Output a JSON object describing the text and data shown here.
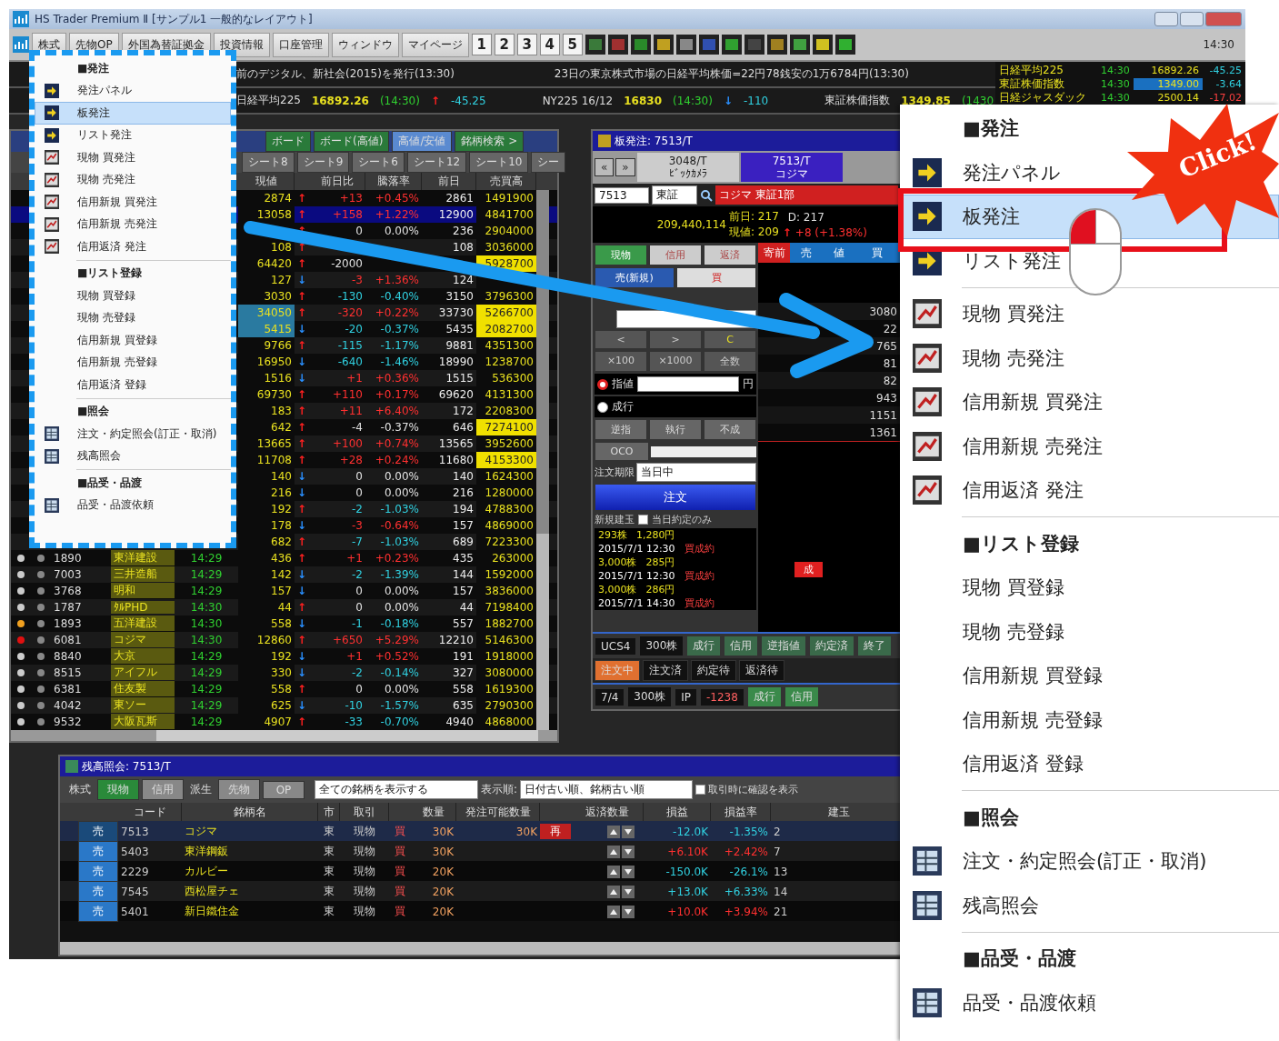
{
  "window": {
    "title": "HS Trader Premium Ⅱ [サンプル1 一般的なレイアウト]",
    "clock": "14:30"
  },
  "menu_bar": [
    "株式",
    "先物OP",
    "外国為替証拠金",
    "投資情報",
    "口座管理",
    "ウィンドウ",
    "マイページ"
  ],
  "page_buttons": [
    "1",
    "2",
    "3",
    "4",
    "5"
  ],
  "news": [
    "前のデジタル、新社会(2015)を発行(13:30)",
    "23日の東京株式市場の日経平均株価=22円78銭安の1万6784円(13:30)"
  ],
  "tickers": [
    {
      "name": "日経平均225",
      "value": "16892.26",
      "time": "(14:30)",
      "arrow": "↑",
      "rising": true,
      "change": "-45.25"
    },
    {
      "name": "NY225 16/12",
      "value": "16830",
      "time": "(14:30)",
      "arrow": "↓",
      "rising": false,
      "change": "-110"
    },
    {
      "name": "東証株価指数",
      "value": "1349.85",
      "time": "(1430"
    }
  ],
  "index_board": [
    {
      "name": "日経平均225",
      "time": "14:30",
      "value": "16892.26",
      "change": "-45.25",
      "selected": false,
      "gain": true
    },
    {
      "name": "東証株価指数",
      "time": "14:30",
      "value": "1349.00",
      "change": "-3.64",
      "selected": true,
      "gain": true
    },
    {
      "name": "日経ジャスダック",
      "time": "14:30",
      "value": "2500.14",
      "change": "-17.02",
      "selected": false,
      "gain": false
    }
  ],
  "watchlist": {
    "toolbar": [
      "ボード",
      "ボード(高値)",
      "高値/安値",
      "銘柄検索 >"
    ],
    "sheets": [
      "シート8",
      "シート9",
      "シート6",
      "シート12",
      "シート10",
      "シー"
    ],
    "columns": [
      "現値",
      "前日比",
      "騰落率",
      "前日",
      "売買高"
    ],
    "rows": [
      {
        "price": "2874",
        "arrow": "↑",
        "rising": true,
        "change": "+13",
        "pct": "+0.45%",
        "prev": "2861",
        "volume": "1491900",
        "gain": true,
        "loss": false,
        "selected": false,
        "highlight": false,
        "price_highlight": false
      },
      {
        "price": "13058",
        "arrow": "↑",
        "rising": true,
        "change": "+158",
        "pct": "+1.22%",
        "prev": "12900",
        "volume": "4841700",
        "gain": true,
        "loss": false,
        "selected": true,
        "highlight": false,
        "price_highlight": false
      },
      {
        "arrow": "↑",
        "rising": true,
        "change": "0",
        "pct": "0.00%",
        "prev": "236",
        "volume": "2904000",
        "gain": false,
        "loss": false,
        "selected": false,
        "highlight": false,
        "price_highlight": false
      },
      {
        "price": "108",
        "arrow": "↑",
        "rising": true,
        "prev": "108",
        "volume": "3036000",
        "selected": false,
        "highlight": false,
        "price_highlight": false
      },
      {
        "price": "64420",
        "arrow": "↑",
        "rising": true,
        "change": "-2000",
        "volume": "5928700",
        "gain": false,
        "loss": false,
        "selected": false,
        "highlight": true,
        "price_highlight": false
      },
      {
        "price": "127",
        "arrow": "↓",
        "rising": false,
        "change": "-3",
        "pct": "+1.36%",
        "prev": "124",
        "gain": true,
        "loss": false,
        "selected": false,
        "highlight": false,
        "price_highlight": false
      },
      {
        "price": "3030",
        "arrow": "↑",
        "rising": true,
        "change": "-130",
        "pct": "-0.40%",
        "prev": "3150",
        "volume": "3796300",
        "gain": false,
        "loss": true,
        "selected": false,
        "highlight": false,
        "price_highlight": false
      },
      {
        "price": "34050",
        "arrow": "↑",
        "rising": true,
        "change": "-320",
        "pct": "+0.22%",
        "prev": "33730",
        "volume": "5266700",
        "gain": true,
        "loss": false,
        "selected": false,
        "highlight": true,
        "price_highlight": true
      },
      {
        "price": "5415",
        "arrow": "↓",
        "rising": false,
        "change": "-20",
        "pct": "-0.37%",
        "prev": "5435",
        "volume": "2082700",
        "gain": false,
        "loss": true,
        "selected": false,
        "highlight": true,
        "price_highlight": true
      },
      {
        "price": "9766",
        "arrow": "↑",
        "rising": true,
        "change": "-115",
        "pct": "-1.17%",
        "prev": "9881",
        "volume": "4351300",
        "gain": false,
        "loss": true,
        "selected": false,
        "highlight": false,
        "price_highlight": false
      },
      {
        "price": "16950",
        "arrow": "↓",
        "rising": false,
        "change": "-640",
        "pct": "-1.46%",
        "prev": "18990",
        "volume": "1238700",
        "gain": false,
        "loss": true,
        "selected": false,
        "highlight": false,
        "price_highlight": false
      },
      {
        "price": "1516",
        "arrow": "↓",
        "rising": false,
        "change": "+1",
        "pct": "+0.36%",
        "prev": "1515",
        "volume": "536300",
        "gain": true,
        "loss": false,
        "selected": false,
        "highlight": false,
        "price_highlight": false
      },
      {
        "price": "69730",
        "arrow": "↑",
        "rising": true,
        "change": "+110",
        "pct": "+0.17%",
        "prev": "69620",
        "volume": "4131300",
        "gain": true,
        "loss": false,
        "selected": false,
        "highlight": false,
        "price_highlight": false
      },
      {
        "price": "183",
        "arrow": "↑",
        "rising": true,
        "change": "+11",
        "pct": "+6.40%",
        "prev": "172",
        "volume": "2208300",
        "gain": true,
        "loss": false,
        "selected": false,
        "highlight": false,
        "price_highlight": false
      },
      {
        "price": "642",
        "arrow": "↑",
        "rising": true,
        "change": "-4",
        "pct": "-0.37%",
        "prev": "646",
        "volume": "7274100",
        "gain": false,
        "loss": false,
        "selected": false,
        "highlight": true,
        "price_highlight": false
      },
      {
        "price": "13665",
        "arrow": "↑",
        "rising": true,
        "change": "+100",
        "pct": "+0.74%",
        "prev": "13565",
        "volume": "3952600",
        "gain": true,
        "loss": false,
        "selected": false,
        "highlight": false,
        "price_highlight": false
      },
      {
        "price": "11708",
        "arrow": "↑",
        "rising": true,
        "change": "+28",
        "pct": "+0.24%",
        "prev": "11680",
        "volume": "4153300",
        "gain": true,
        "loss": false,
        "selected": false,
        "highlight": true,
        "price_highlight": false
      },
      {
        "price": "140",
        "arrow": "↓",
        "rising": false,
        "change": "0",
        "pct": "0.00%",
        "prev": "140",
        "volume": "1624300",
        "gain": false,
        "loss": false,
        "selected": false,
        "highlight": false,
        "price_highlight": false
      },
      {
        "price": "216",
        "arrow": "↓",
        "rising": false,
        "change": "0",
        "pct": "0.00%",
        "prev": "216",
        "volume": "1280000",
        "gain": false,
        "loss": false,
        "selected": false,
        "highlight": false,
        "price_highlight": false
      },
      {
        "price": "192",
        "arrow": "↑",
        "rising": true,
        "change": "-2",
        "pct": "-1.03%",
        "prev": "194",
        "volume": "4788300",
        "gain": false,
        "loss": true,
        "selected": false,
        "highlight": false,
        "price_highlight": false
      },
      {
        "price": "178",
        "arrow": "↓",
        "rising": false,
        "change": "-3",
        "pct": "-0.64%",
        "prev": "157",
        "volume": "4869000",
        "gain": true,
        "loss": false,
        "selected": false,
        "highlight": false,
        "price_highlight": false
      },
      {
        "price": "682",
        "arrow": "↑",
        "rising": true,
        "change": "-7",
        "pct": "-1.03%",
        "prev": "689",
        "volume": "7223300",
        "gain": false,
        "loss": true,
        "selected": false,
        "highlight": false,
        "price_highlight": false
      },
      {
        "code": "1890",
        "name": "東洋建設",
        "time": "14:29",
        "price": "436",
        "arrow": "↑",
        "rising": true,
        "change": "+1",
        "pct": "+0.23%",
        "prev": "435",
        "volume": "263000",
        "gain": true,
        "loss": false,
        "color": "#cccccc",
        "selected": false,
        "highlight": false,
        "price_highlight": false
      },
      {
        "code": "7003",
        "name": "三井造船",
        "time": "14:29",
        "price": "142",
        "arrow": "↓",
        "rising": false,
        "change": "-2",
        "pct": "-1.39%",
        "prev": "144",
        "volume": "1592000",
        "gain": false,
        "loss": true,
        "color": "#cccccc",
        "selected": false,
        "highlight": false,
        "price_highlight": false
      },
      {
        "code": "3768",
        "name": "明和",
        "time": "14:29",
        "price": "157",
        "arrow": "↓",
        "rising": false,
        "change": "0",
        "pct": "0.00%",
        "prev": "157",
        "volume": "3836000",
        "gain": false,
        "loss": false,
        "color": "#cccccc",
        "selected": false,
        "highlight": false,
        "price_highlight": false
      },
      {
        "code": "1787",
        "name": "ﾀﾙPHD",
        "time": "14:30",
        "price": "44",
        "arrow": "↑",
        "rising": true,
        "change": "0",
        "pct": "0.00%",
        "prev": "44",
        "volume": "7198400",
        "gain": false,
        "loss": false,
        "color": "#cccccc",
        "selected": false,
        "highlight": false,
        "price_highlight": false
      },
      {
        "code": "1893",
        "name": "五洋建設",
        "time": "14:30",
        "price": "558",
        "arrow": "↓",
        "rising": false,
        "change": "-1",
        "pct": "-0.18%",
        "prev": "557",
        "volume": "1882700",
        "gain": false,
        "loss": true,
        "color": "#f0a020",
        "selected": false,
        "highlight": false,
        "price_highlight": false
      },
      {
        "code": "6081",
        "name": "コジマ",
        "time": "14:30",
        "price": "12860",
        "arrow": "↑",
        "rising": true,
        "change": "+650",
        "pct": "+5.29%",
        "prev": "12210",
        "volume": "5146300",
        "gain": true,
        "loss": false,
        "color": "#e01010",
        "selected": false,
        "highlight": false,
        "price_highlight": false
      },
      {
        "code": "8840",
        "name": "大京",
        "time": "14:29",
        "price": "192",
        "arrow": "↓",
        "rising": false,
        "change": "+1",
        "pct": "+0.52%",
        "prev": "191",
        "volume": "1918000",
        "gain": true,
        "loss": false,
        "color": "#cccccc",
        "selected": false,
        "highlight": false,
        "price_highlight": false
      },
      {
        "code": "8515",
        "name": "アイフル",
        "time": "14:29",
        "price": "330",
        "arrow": "↓",
        "rising": false,
        "change": "-2",
        "pct": "-0.14%",
        "prev": "327",
        "volume": "3080000",
        "gain": false,
        "loss": true,
        "color": "#cccccc",
        "selected": false,
        "highlight": false,
        "price_highlight": false
      },
      {
        "code": "6381",
        "name": "住友製",
        "time": "14:29",
        "price": "558",
        "arrow": "↑",
        "rising": true,
        "change": "0",
        "pct": "0.00%",
        "prev": "558",
        "volume": "1619300",
        "gain": false,
        "loss": false,
        "color": "#cccccc",
        "selected": false,
        "highlight": false,
        "price_highlight": false
      },
      {
        "code": "4042",
        "name": "東ソー",
        "time": "14:29",
        "price": "625",
        "arrow": "↓",
        "rising": false,
        "change": "-10",
        "pct": "-1.57%",
        "prev": "635",
        "volume": "2790300",
        "gain": false,
        "loss": true,
        "color": "#cccccc",
        "selected": false,
        "highlight": false,
        "price_highlight": false
      },
      {
        "code": "9532",
        "name": "大阪瓦斯",
        "time": "14:29",
        "price": "4907",
        "arrow": "↑",
        "rising": true,
        "change": "-33",
        "pct": "-0.70%",
        "prev": "4940",
        "volume": "4868000",
        "gain": false,
        "loss": true,
        "color": "#cccccc",
        "selected": false,
        "highlight": false,
        "price_highlight": false
      }
    ]
  },
  "order_panel": {
    "title": "板発注: 7513/T",
    "nav": [
      "«",
      "»"
    ],
    "tabs": [
      {
        "code": "3048/T",
        "name": "ﾋﾞｯｸｶﾒﾗ",
        "selected": false
      },
      {
        "code": "7513/T",
        "name": "コジマ",
        "selected": true
      }
    ],
    "code": "7513",
    "market": "東証",
    "stock": "コジマ 東証1部",
    "amount": "209,440,114",
    "prev": "前日: 217",
    "d": "D: 217",
    "current": "現値: 209",
    "current_arrow": "↑",
    "current_change": "+8 (+1.38%)",
    "trade_tabs": [
      {
        "label": "現物",
        "selected": true
      },
      {
        "label": "信用",
        "selected": false
      },
      {
        "label": "返済",
        "selected": false
      }
    ],
    "sides": [
      {
        "label": "売(新規)",
        "selected": true
      },
      {
        "label": "買",
        "selected": false
      }
    ],
    "keys": [
      "<",
      ">",
      "C",
      "×100",
      "×1000",
      "全数"
    ],
    "price_types": [
      {
        "label": "指値",
        "selected": true
      },
      {
        "label": "成行",
        "selected": false
      }
    ],
    "yen": "円",
    "conditions": [
      "逆指",
      "執行",
      "不成"
    ],
    "oco": "OCO",
    "deadline_label": "注文期限",
    "deadline": "当日中",
    "submit": "注文",
    "history_label": "新規建玉",
    "today_only": {
      "label": "当日約定のみ",
      "checked": false
    },
    "history": [
      {
        "a": "293株",
        "b": "1,280円"
      },
      {
        "a": "2015/7/1 12:30",
        "b": "買成約"
      },
      {
        "a": "3,000株",
        "b": "285円"
      },
      {
        "a": "2015/7/1 12:30",
        "b": "買成約"
      },
      {
        "a": "3,000株",
        "b": "286円"
      },
      {
        "a": "2015/7/1 14:30",
        "b": "買成約"
      }
    ],
    "board_header": [
      "寄前",
      "売",
      "値",
      "買"
    ],
    "board": [
      "3080",
      "22",
      "765",
      "81",
      "82",
      "943",
      "1151",
      "1361"
    ],
    "market_flag": "成",
    "strip1": [
      "UCS4",
      "300株",
      "成行",
      "信用",
      "逆指値",
      "約定済",
      "終了"
    ],
    "strip2": [
      {
        "label": "注文中",
        "selected": true
      },
      {
        "label": "注文済",
        "selected": false
      },
      {
        "label": "約定待",
        "selected": false
      },
      {
        "label": "返済待",
        "selected": false
      }
    ],
    "strip3": [
      "7/4",
      "300株",
      "IP",
      "-1238",
      "成行",
      "信用"
    ]
  },
  "positions": {
    "title": "残高照会: 7513/T",
    "filters": [
      {
        "label": "株式",
        "kind": "label",
        "selected": false
      },
      {
        "label": "現物",
        "kind": "toggle",
        "selected": true
      },
      {
        "label": "信用",
        "kind": "toggle",
        "selected": false
      },
      {
        "label": "派生",
        "kind": "label",
        "selected": false
      },
      {
        "label": "先物",
        "kind": "toggle",
        "selected": false
      },
      {
        "label": "OP",
        "kind": "toggle",
        "selected": false
      }
    ],
    "scope": "全ての銘柄を表示する",
    "order_label": "表示順:",
    "order": "日付古い順、銘柄古い順",
    "confirm": {
      "label": "取引時に確認を表示",
      "checked": false
    },
    "columns": [
      "コード",
      "銘柄名",
      "市",
      "取引",
      "数量",
      "発注可能数量",
      "返済数量",
      "損益",
      "損益率",
      "建玉"
    ],
    "rows": [
      {
        "action": "売",
        "code": "7513",
        "name": "コジマ",
        "market": "東",
        "trade": "現物",
        "side": "買",
        "qty": "30K",
        "avail": "30K",
        "flag": "再",
        "pl": "-12.0K",
        "rate": "-1.35%",
        "gain": false,
        "selected": true,
        "days": "2"
      },
      {
        "action": "売",
        "code": "5403",
        "name": "東洋鋼鈑",
        "market": "東",
        "trade": "現物",
        "side": "買",
        "qty": "30K",
        "pl": "+6.10K",
        "rate": "+2.42%",
        "gain": true,
        "selected": false,
        "days": "7"
      },
      {
        "action": "売",
        "code": "2229",
        "name": "カルビー",
        "market": "東",
        "trade": "現物",
        "side": "買",
        "qty": "20K",
        "pl": "-150.0K",
        "rate": "-26.1%",
        "gain": false,
        "selected": false,
        "days": "13"
      },
      {
        "action": "売",
        "code": "7545",
        "name": "西松屋チェ",
        "market": "東",
        "trade": "現物",
        "side": "買",
        "qty": "20K",
        "pl": "+13.0K",
        "rate": "+6.33%",
        "gain": false,
        "selected": false,
        "days": "14"
      },
      {
        "action": "売",
        "code": "5401",
        "name": "新日鐵住金",
        "market": "東",
        "trade": "現物",
        "side": "買",
        "qty": "20K",
        "pl": "+10.0K",
        "rate": "+3.94%",
        "gain": true,
        "selected": false,
        "days": "21"
      }
    ]
  },
  "menu": [
    {
      "label": "■発注",
      "kind": "header"
    },
    {
      "label": "発注パネル",
      "kind": "panel",
      "selected": false
    },
    {
      "label": "板発注",
      "kind": "panel",
      "selected": true
    },
    {
      "label": "リスト発注",
      "kind": "panel",
      "selected": false
    },
    {
      "label": "現物 買発注",
      "kind": "chart",
      "selected": false
    },
    {
      "label": "現物 売発注",
      "kind": "chart",
      "selected": false
    },
    {
      "label": "信用新規 買発注",
      "kind": "chart",
      "selected": false
    },
    {
      "label": "信用新規 売発注",
      "kind": "chart",
      "selected": false
    },
    {
      "label": "信用返済 発注",
      "kind": "chart",
      "selected": false
    },
    {
      "kind": "divider"
    },
    {
      "label": "■リスト登録",
      "kind": "header"
    },
    {
      "label": "現物 買登録",
      "kind": "text",
      "selected": false
    },
    {
      "label": "現物 売登録",
      "kind": "text",
      "selected": false
    },
    {
      "label": "信用新規 買登録",
      "kind": "text",
      "selected": false
    },
    {
      "label": "信用新規 売登録",
      "kind": "text",
      "selected": false
    },
    {
      "label": "信用返済 登録",
      "kind": "text",
      "selected": false
    },
    {
      "kind": "divider"
    },
    {
      "label": "■照会",
      "kind": "header"
    },
    {
      "label": "注文・約定照会(訂正・取消)",
      "kind": "table",
      "selected": false
    },
    {
      "label": "残高照会",
      "kind": "table",
      "selected": false
    },
    {
      "kind": "divider"
    },
    {
      "label": "■品受・品渡",
      "kind": "header"
    },
    {
      "label": "品受・品渡依頼",
      "kind": "table",
      "selected": false
    }
  ],
  "zoom_menu": [
    {
      "label": "■発注",
      "kind": "header"
    },
    {
      "label": "発注パネル",
      "kind": "panel",
      "selected": false
    },
    {
      "label": "板発注",
      "kind": "panel",
      "selected": true
    },
    {
      "label": "リスト発注",
      "kind": "panel",
      "selected": false
    },
    {
      "kind": "divider"
    },
    {
      "label": "現物 買発注",
      "kind": "chart",
      "selected": false
    },
    {
      "label": "現物 売発注",
      "kind": "chart",
      "selected": false
    },
    {
      "label": "信用新規 買発注",
      "kind": "chart",
      "selected": false
    },
    {
      "label": "信用新規 売発注",
      "kind": "chart",
      "selected": false
    },
    {
      "label": "信用返済 発注",
      "kind": "chart",
      "selected": false
    },
    {
      "kind": "divider"
    },
    {
      "label": "■リスト登録",
      "kind": "header"
    },
    {
      "label": "現物 買登録",
      "kind": "text",
      "selected": false
    },
    {
      "label": "現物 売登録",
      "kind": "text",
      "selected": false
    },
    {
      "label": "信用新規 買登録",
      "kind": "text",
      "selected": false
    },
    {
      "label": "信用新規 売登録",
      "kind": "text",
      "selected": false
    },
    {
      "label": "信用返済 登録",
      "kind": "text",
      "selected": false
    },
    {
      "kind": "divider"
    },
    {
      "label": "■照会",
      "kind": "header"
    },
    {
      "label": "注文・約定照会(訂正・取消)",
      "kind": "table",
      "selected": false
    },
    {
      "label": "残高照会",
      "kind": "table",
      "selected": false
    },
    {
      "kind": "divider"
    },
    {
      "label": "■品受・品渡",
      "kind": "header"
    },
    {
      "label": "品受・品渡依頼",
      "kind": "table",
      "selected": false
    }
  ],
  "callout": {
    "label": "Click!"
  }
}
